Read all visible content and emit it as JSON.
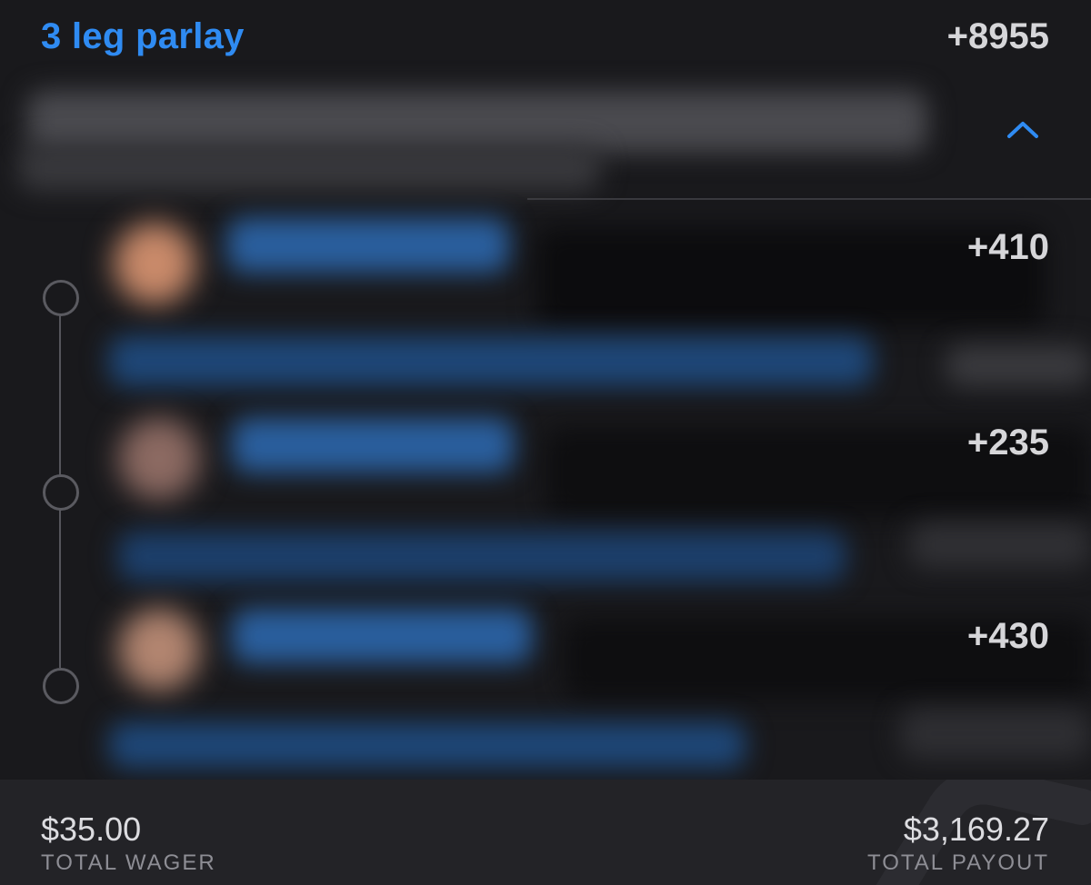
{
  "bet": {
    "title": "3 leg parlay",
    "odds": "+8955",
    "expanded": true,
    "collapse_icon": "chevron-up-icon"
  },
  "legs": [
    {
      "odds": "+410"
    },
    {
      "odds": "+235"
    },
    {
      "odds": "+430"
    }
  ],
  "footer": {
    "wager_amount": "$35.00",
    "wager_label": "TOTAL WAGER",
    "payout_amount": "$3,169.27",
    "payout_label": "TOTAL PAYOUT"
  },
  "colors": {
    "accent": "#2f8bf2",
    "background": "#19191c",
    "footer_background": "#232327",
    "text_primary": "#d6d6d9",
    "text_secondary": "#8e8e95"
  }
}
